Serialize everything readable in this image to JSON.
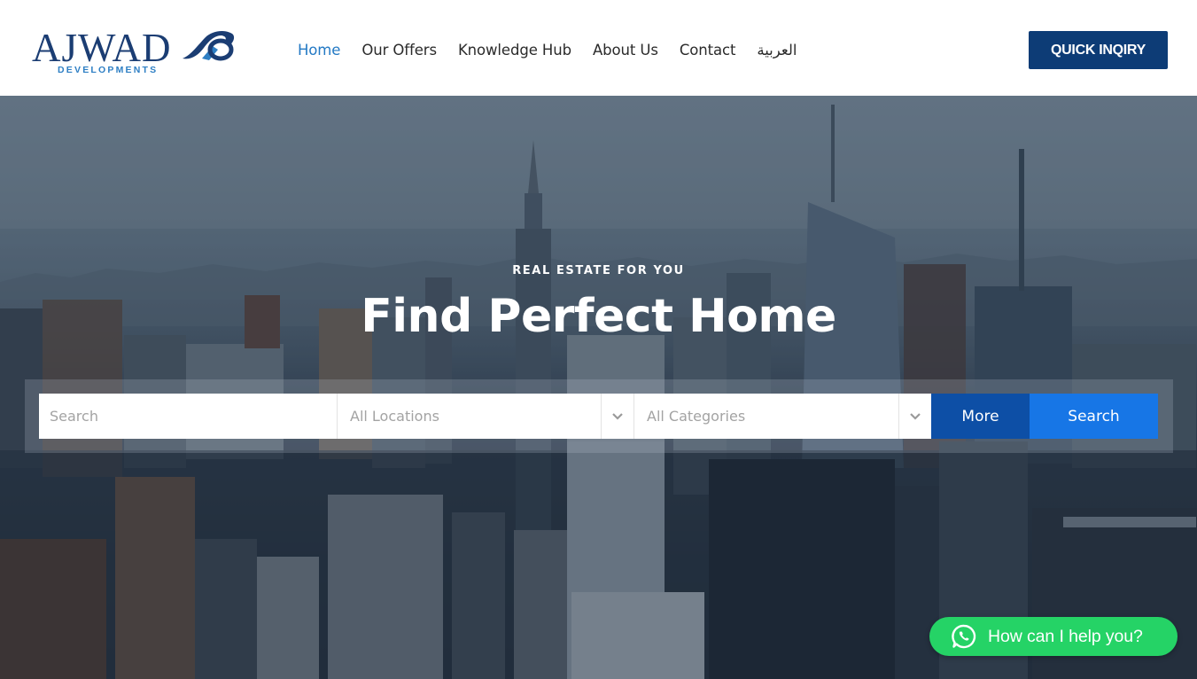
{
  "brand": {
    "name": "AJWAD",
    "tagline": "DEVELOPMENTS",
    "primary_color": "#0d3c76",
    "accent_color": "#2379c4"
  },
  "nav": {
    "items": [
      {
        "label": "Home",
        "active": true
      },
      {
        "label": "Our Offers",
        "active": false
      },
      {
        "label": "Knowledge Hub",
        "active": false
      },
      {
        "label": "About Us",
        "active": false
      },
      {
        "label": "Contact",
        "active": false
      },
      {
        "label": "العربية",
        "active": false
      }
    ],
    "cta_label": "QUICK INQIRY"
  },
  "hero": {
    "kicker": "REAL ESTATE FOR YOU",
    "title": "Find Perfect Home",
    "background_icon": "city-skyline-photo"
  },
  "search": {
    "placeholder": "Search",
    "location_select": "All Locations",
    "category_select": "All Categories",
    "more_label": "More",
    "search_label": "Search",
    "more_color": "#0d4fa6",
    "search_color": "#1776e6"
  },
  "chat": {
    "label": "How can I help you?",
    "icon": "whatsapp-icon",
    "color": "#25d366"
  }
}
